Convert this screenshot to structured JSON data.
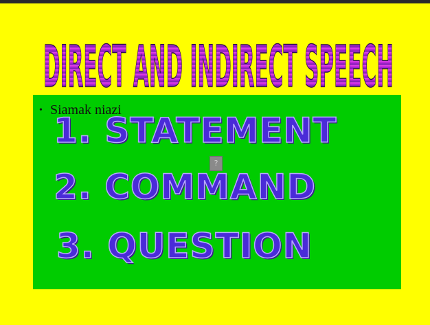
{
  "slide": {
    "title": "DIRECT AND INDIRECT SPEECH",
    "author_bullet": "Siamak niazi",
    "items": [
      "1. STATEMENT",
      "2. COMMAND",
      "3. QUESTION"
    ],
    "placeholder_icon_glyph": "?"
  },
  "colors": {
    "background": "#ffff00",
    "content_box": "#00cc00",
    "title_gradient_top": "#ff33ff",
    "title_gradient_bottom": "#6a1aa8",
    "item_text": "#4a2bd8"
  }
}
